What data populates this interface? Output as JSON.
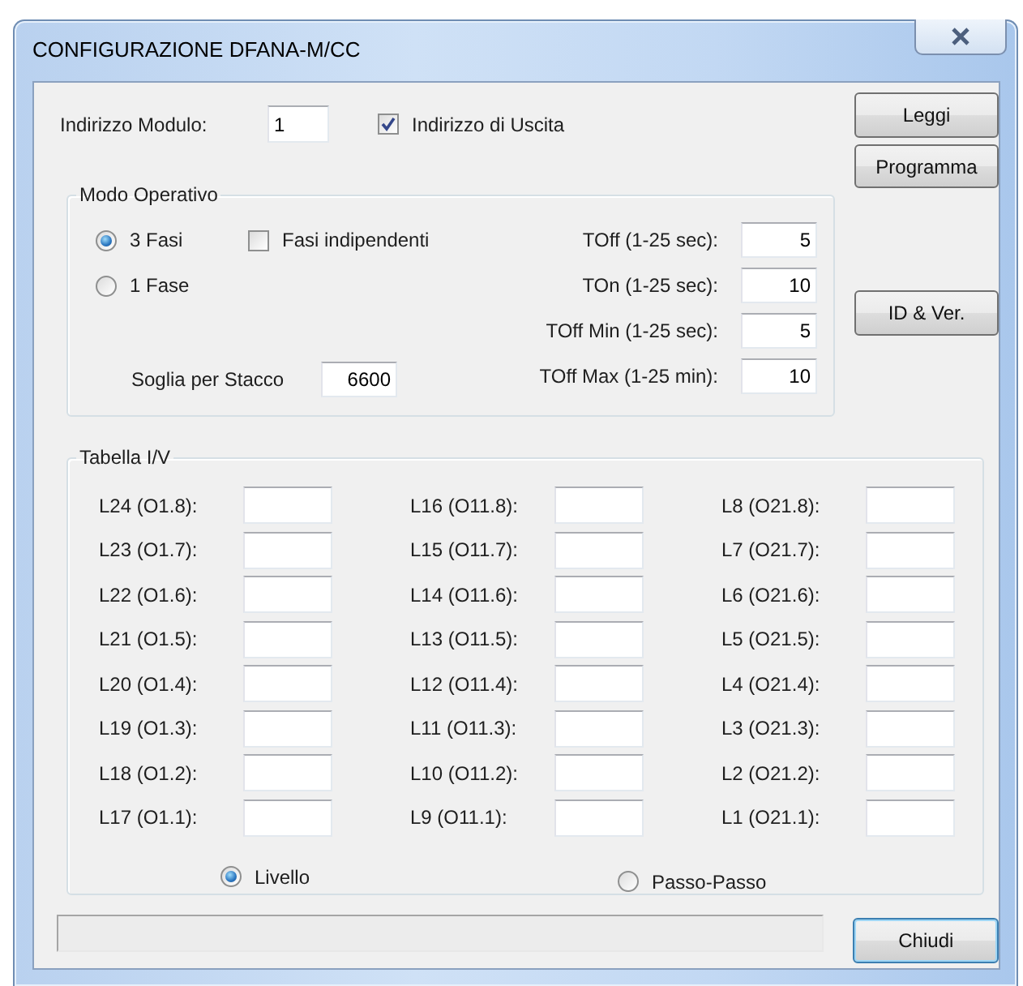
{
  "window": {
    "title": "CONFIGURAZIONE DFANA-M/CC"
  },
  "indirizzo_modulo": {
    "label": "Indirizzo Modulo:",
    "value": "1"
  },
  "indirizzo_uscita": {
    "label": "Indirizzo di Uscita",
    "checked": true
  },
  "buttons": [
    {
      "label": "Leggi"
    },
    {
      "label": "Programma"
    },
    {
      "label": "ID & Ver."
    }
  ],
  "modo_operativo": {
    "title": "Modo Operativo",
    "phases": [
      {
        "label": "3 Fasi",
        "selected": true
      },
      {
        "label": "1 Fase",
        "selected": false
      }
    ],
    "fasi_indipendenti": {
      "label": "Fasi indipendenti",
      "checked": false
    },
    "timings": [
      {
        "label": "TOff (1-25 sec):",
        "value": "5"
      },
      {
        "label": "TOn (1-25 sec):",
        "value": "10"
      },
      {
        "label": "TOff Min (1-25 sec):",
        "value": "5"
      },
      {
        "label": "TOff Max (1-25 min):",
        "value": "10"
      }
    ],
    "soglia": {
      "label": "Soglia per Stacco",
      "value": "6600"
    }
  },
  "tabella": {
    "title": "Tabella I/V",
    "columns": [
      [
        "L24 (O1.8):",
        "L23 (O1.7):",
        "L22 (O1.6):",
        "L21 (O1.5):",
        "L20 (O1.4):",
        "L19 (O1.3):",
        "L18 (O1.2):",
        "L17 (O1.1):"
      ],
      [
        "L16 (O11.8):",
        "L15 (O11.7):",
        "L14 (O11.6):",
        "L13 (O11.5):",
        "L12 (O11.4):",
        "L11 (O11.3):",
        "L10 (O11.2):",
        "L9 (O11.1):"
      ],
      [
        "L8 (O21.8):",
        "L7 (O21.7):",
        "L6 (O21.6):",
        "L5 (O21.5):",
        "L4 (O21.4):",
        "L3 (O21.3):",
        "L2 (O21.2):",
        "L1 (O21.1):"
      ]
    ],
    "modes": [
      {
        "label": "Livello",
        "selected": true
      },
      {
        "label": "Passo-Passo",
        "selected": false
      }
    ]
  },
  "close_button": {
    "label": "Chiudi"
  }
}
